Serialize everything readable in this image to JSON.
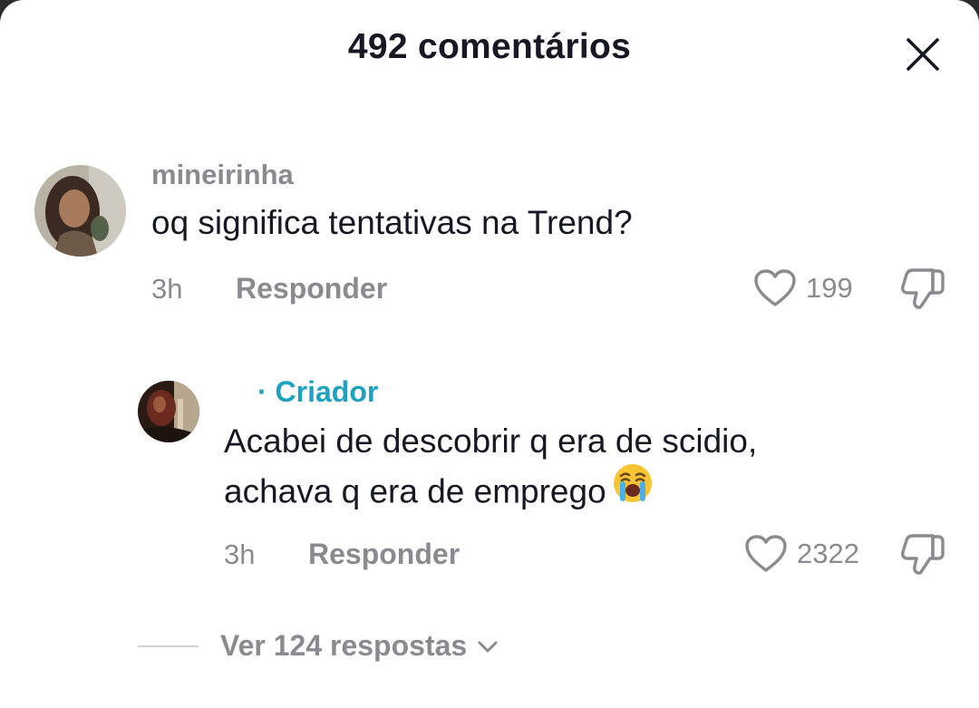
{
  "header": {
    "title": "492 comentários"
  },
  "comments": [
    {
      "username": "mineirinha",
      "text": "oq significa tentativas na Trend?",
      "time": "3h",
      "reply_label": "Responder",
      "likes": "199"
    }
  ],
  "reply": {
    "username": "",
    "creator_tag": "· Criador",
    "text_line1": "Acabei de descobrir q era de scidio,",
    "text_line2": "achava q era de emprego",
    "time": "3h",
    "reply_label": "Responder",
    "likes": "2322"
  },
  "view_replies": {
    "label": "Ver 124 respostas"
  },
  "icons": {
    "close": "close-icon",
    "like": "heart-icon",
    "dislike": "thumbs-down-icon",
    "expand": "chevron-down-icon",
    "emoji": "crying-face-emoji"
  },
  "colors": {
    "text_primary": "#161823",
    "text_secondary": "#8a8b91",
    "creator_accent": "#1fa2c1"
  }
}
